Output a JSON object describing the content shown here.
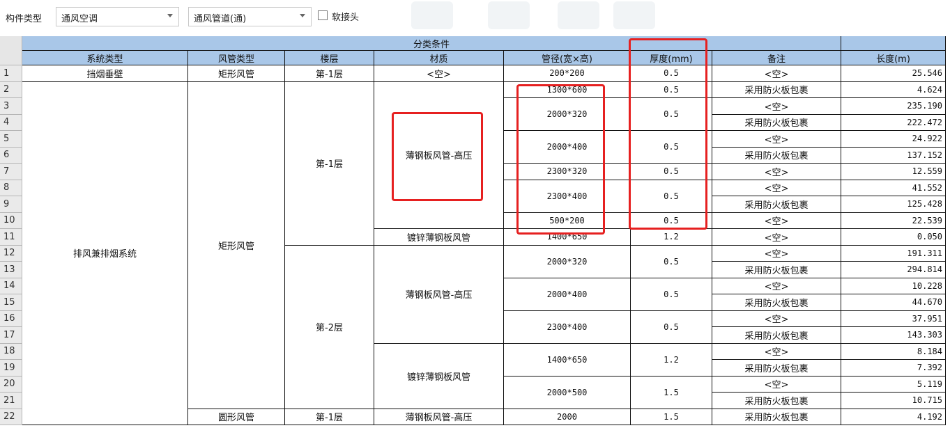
{
  "toolbar": {
    "label": "构件类型",
    "combo1": "通风空调",
    "combo2": "通风管道(通)",
    "checkbox_label": "软接头"
  },
  "headers": {
    "group": "分类条件",
    "system_type": "系统类型",
    "duct_type": "风管类型",
    "floor": "楼层",
    "material": "材质",
    "size": "管径(宽×高)",
    "thickness": "厚度(mm)",
    "remark": "备注",
    "length": "长度(m)"
  },
  "row_numbers": [
    "1",
    "2",
    "3",
    "4",
    "5",
    "6",
    "7",
    "8",
    "9",
    "10",
    "11",
    "12",
    "13",
    "14",
    "15",
    "16",
    "17",
    "18",
    "19",
    "20",
    "21",
    "22"
  ],
  "systems": [
    "挡烟垂壁",
    "排风兼排烟系统"
  ],
  "duct_types": [
    "矩形风管",
    "矩形风管",
    "圆形风管"
  ],
  "floors": [
    "第-1层",
    "第-1层",
    "第-2层",
    "第-1层"
  ],
  "materials": [
    "<空>",
    "薄钢板风管-高压",
    "镀锌薄钢板风管",
    "薄钢板风管-高压",
    "镀锌薄钢板风管",
    "薄钢板风管-高压"
  ],
  "sizes": [
    "200*200",
    "1300*600",
    "2000*320",
    "2000*400",
    "2300*320",
    "2300*400",
    "500*200",
    "1400*650",
    "2000*320",
    "2000*400",
    "2300*400",
    "1400*650",
    "2000*500",
    "2000"
  ],
  "thicknesses": [
    "0.5",
    "0.5",
    "0.5",
    "0.5",
    "0.5",
    "0.5",
    "0.5",
    "1.2",
    "0.5",
    "0.5",
    "0.5",
    "1.2",
    "1.5",
    "1.5"
  ],
  "remarks": [
    "<空>",
    "采用防火板包裹",
    "<空>",
    "采用防火板包裹",
    "<空>",
    "采用防火板包裹",
    "<空>",
    "<空>",
    "采用防火板包裹",
    "<空>",
    "<空>",
    "<空>",
    "采用防火板包裹",
    "<空>",
    "采用防火板包裹",
    "<空>",
    "采用防火板包裹",
    "<空>",
    "采用防火板包裹",
    "<空>",
    "采用防火板包裹",
    "采用防火板包裹"
  ],
  "lengths": [
    "25.546",
    "4.624",
    "235.190",
    "222.472",
    "24.922",
    "137.152",
    "12.559",
    "41.552",
    "125.428",
    "22.539",
    "0.050",
    "191.311",
    "294.814",
    "10.228",
    "44.670",
    "37.951",
    "143.303",
    "8.184",
    "7.392",
    "5.119",
    "10.715",
    "4.192"
  ]
}
